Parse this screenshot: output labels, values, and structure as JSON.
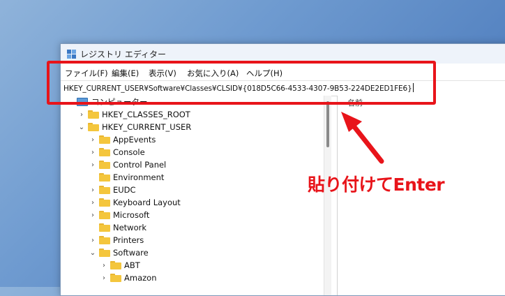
{
  "window": {
    "title": "レジストリ エディター"
  },
  "menu": {
    "items": [
      {
        "label": "ファイル(F)"
      },
      {
        "label": "編集(E)"
      },
      {
        "label": "表示(V)"
      },
      {
        "label": "お気に入り(A)"
      },
      {
        "label": "ヘルプ(H)"
      }
    ]
  },
  "address": {
    "value": "HKEY_CURRENT_USER¥Software¥Classes¥CLSID¥{018D5C66-4533-4307-9B53-224DE2ED1FE6}"
  },
  "tree": {
    "root_label": "コンピューター",
    "items": [
      {
        "label": "HKEY_CLASSES_ROOT",
        "expanded": false
      },
      {
        "label": "HKEY_CURRENT_USER",
        "expanded": true
      },
      {
        "label": "AppEvents",
        "expanded": false
      },
      {
        "label": "Console",
        "expanded": false
      },
      {
        "label": "Control Panel",
        "expanded": false
      },
      {
        "label": "Environment",
        "expanded": false
      },
      {
        "label": "EUDC",
        "expanded": false
      },
      {
        "label": "Keyboard Layout",
        "expanded": false
      },
      {
        "label": "Microsoft",
        "expanded": false
      },
      {
        "label": "Network",
        "expanded": false
      },
      {
        "label": "Printers",
        "expanded": false
      },
      {
        "label": "Software",
        "expanded": true
      },
      {
        "label": "ABT",
        "expanded": false
      },
      {
        "label": "Amazon",
        "expanded": false
      }
    ]
  },
  "right_pane": {
    "column_name": "名前"
  },
  "annotation": {
    "text": "貼り付けてEnter",
    "color": "#e8141a"
  }
}
